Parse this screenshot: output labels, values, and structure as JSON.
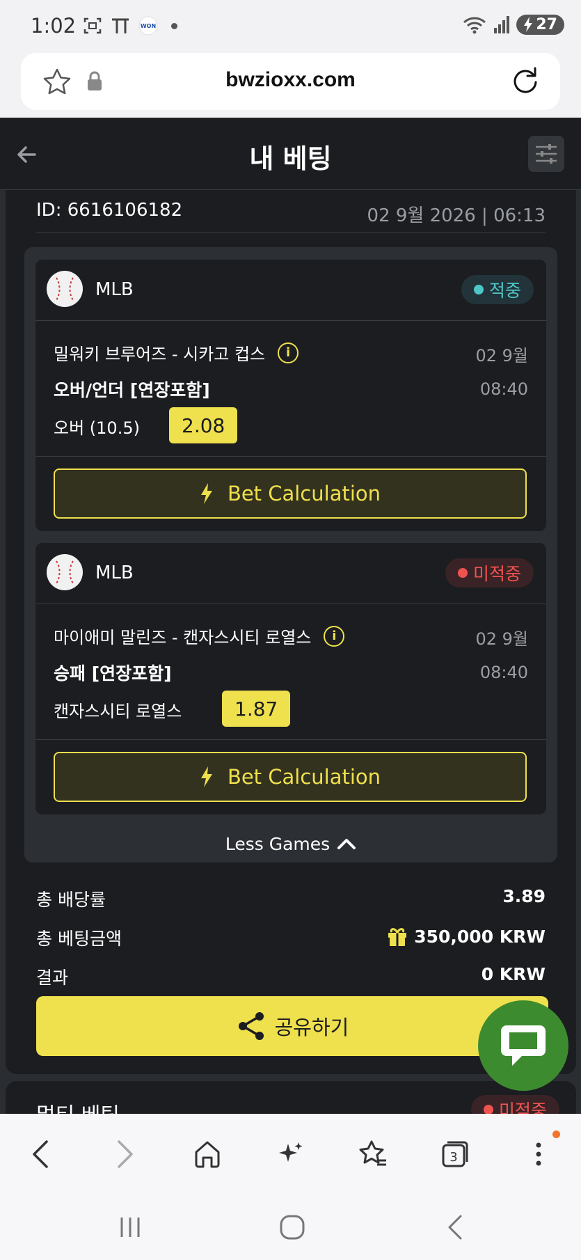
{
  "status_bar": {
    "time": "1:02",
    "battery": "27"
  },
  "browser": {
    "url": "bwzioxx.com",
    "tab_count": "3"
  },
  "header": {
    "title": "내 베팅"
  },
  "bet": {
    "id_text": "ID: 6616106182",
    "datetime": "02 9월 2026 | 06:13",
    "games": [
      {
        "league": "MLB",
        "status": "적중",
        "match": "밀워키 브루어즈 - 시카고 컵스",
        "date": "02 9월",
        "time": "08:40",
        "market": "오버/언더 [연장포함]",
        "pick": "오버 (10.5)",
        "odds": "2.08",
        "calc_label": "Bet Calculation"
      },
      {
        "league": "MLB",
        "status": "미적중",
        "match": "마이애미 말린즈 - 캔자스시티 로열스",
        "date": "02 9월",
        "time": "08:40",
        "market": "승패 [연장포함]",
        "pick": "캔자스시티 로열스",
        "odds": "1.87",
        "calc_label": "Bet Calculation"
      }
    ],
    "less_games_label": "Less Games",
    "summary": {
      "total_odds_label": "총 배당률",
      "total_odds": "3.89",
      "total_stake_label": "총 베팅금액",
      "total_stake": "350,000 KRW",
      "result_label": "결과",
      "result": "0 KRW"
    },
    "share_label": "공유하기"
  },
  "next_card": {
    "title": "멀티 베팅",
    "status": "미적중"
  },
  "colors": {
    "accent": "#efe04d",
    "win": "#4fc6c6",
    "lose": "#ef5350",
    "chat": "#3d8b2f"
  }
}
